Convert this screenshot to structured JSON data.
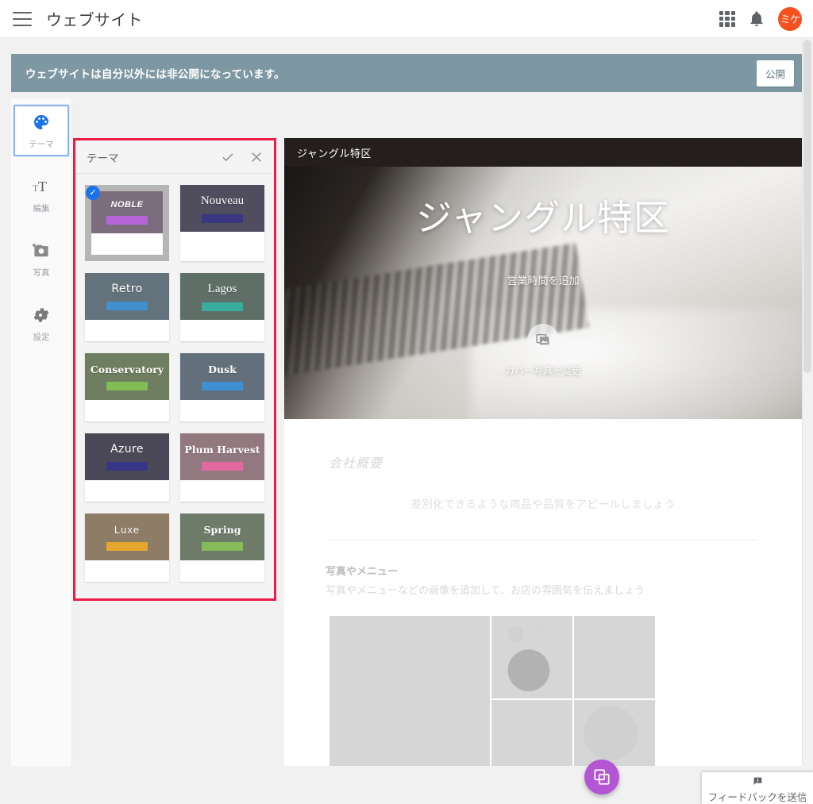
{
  "appbar": {
    "menu_icon": "hamburger-menu-icon",
    "title": "ウェブサイト",
    "apps_icon": "apps-grid-icon",
    "notifications_icon": "bell-icon",
    "avatar_initials": "ミケ",
    "avatar_color": "#f4511e"
  },
  "banner": {
    "message": "ウェブサイトは自分以外には非公開になっています。",
    "publish_label": "公開",
    "background": "#7e98a3"
  },
  "sidebar": {
    "items": [
      {
        "label": "テーマ",
        "icon": "palette-icon",
        "selected": true
      },
      {
        "label": "編集",
        "icon": "text-format-icon",
        "selected": false
      },
      {
        "label": "写真",
        "icon": "add-photo-icon",
        "selected": false
      },
      {
        "label": "設定",
        "icon": "gear-icon",
        "selected": false
      }
    ]
  },
  "theme_panel": {
    "title": "テーマ",
    "confirm_icon": "check-icon",
    "close_icon": "close-icon",
    "highlight_color": "#ec1c4b",
    "themes": [
      {
        "name": "NOBLE",
        "bg": "#7c6d7e",
        "accent": "#b663d8",
        "font": "ff-condensed",
        "selected": true
      },
      {
        "name": "Nouveau",
        "bg": "#4f4d5e",
        "accent": "#383780",
        "font": "ff-serif",
        "selected": false
      },
      {
        "name": "Retro",
        "bg": "#64727c",
        "accent": "#4190cd",
        "font": "ff-sans",
        "selected": false
      },
      {
        "name": "Lagos",
        "bg": "#5f6f68",
        "accent": "#3aac9d",
        "font": "ff-serif",
        "selected": false
      },
      {
        "name": "Conservatory",
        "bg": "#6f7d60",
        "accent": "#82bc55",
        "font": "ff-slab",
        "selected": false
      },
      {
        "name": "Dusk",
        "bg": "#63707c",
        "accent": "#3f90d2",
        "font": "ff-slab",
        "selected": false
      },
      {
        "name": "Azure",
        "bg": "#4b4858",
        "accent": "#373686",
        "font": "ff-sans",
        "selected": false
      },
      {
        "name": "Plum Harvest",
        "bg": "#92787f",
        "accent": "#e2689f",
        "font": "ff-slab",
        "selected": false
      },
      {
        "name": "Luxe",
        "bg": "#8e7d66",
        "accent": "#e5a62f",
        "font": "ff-light",
        "selected": false
      },
      {
        "name": "Spring",
        "bg": "#6d7b68",
        "accent": "#85bb5b",
        "font": "ff-slab",
        "selected": false
      }
    ]
  },
  "preview": {
    "nav_title": "ジャングル特区",
    "hero_title": "ジャングル特区",
    "hours_label": "営業時間を追加",
    "cover_change_label": "カバー写真を変更",
    "cover_icon": "image-collection-icon",
    "about_title": "会社概要",
    "about_body": "差別化できるような商品や品質をアピールしましょう",
    "photos_title": "写真やメニュー",
    "photos_sub": "写真やメニューなどの画像を追加して、お店の雰囲気を伝えましょう"
  },
  "fab": {
    "icon": "duplicate-images-icon",
    "color": "#b455d4"
  },
  "feedback": {
    "icon": "feedback-icon",
    "label": "フィードバックを送信"
  }
}
